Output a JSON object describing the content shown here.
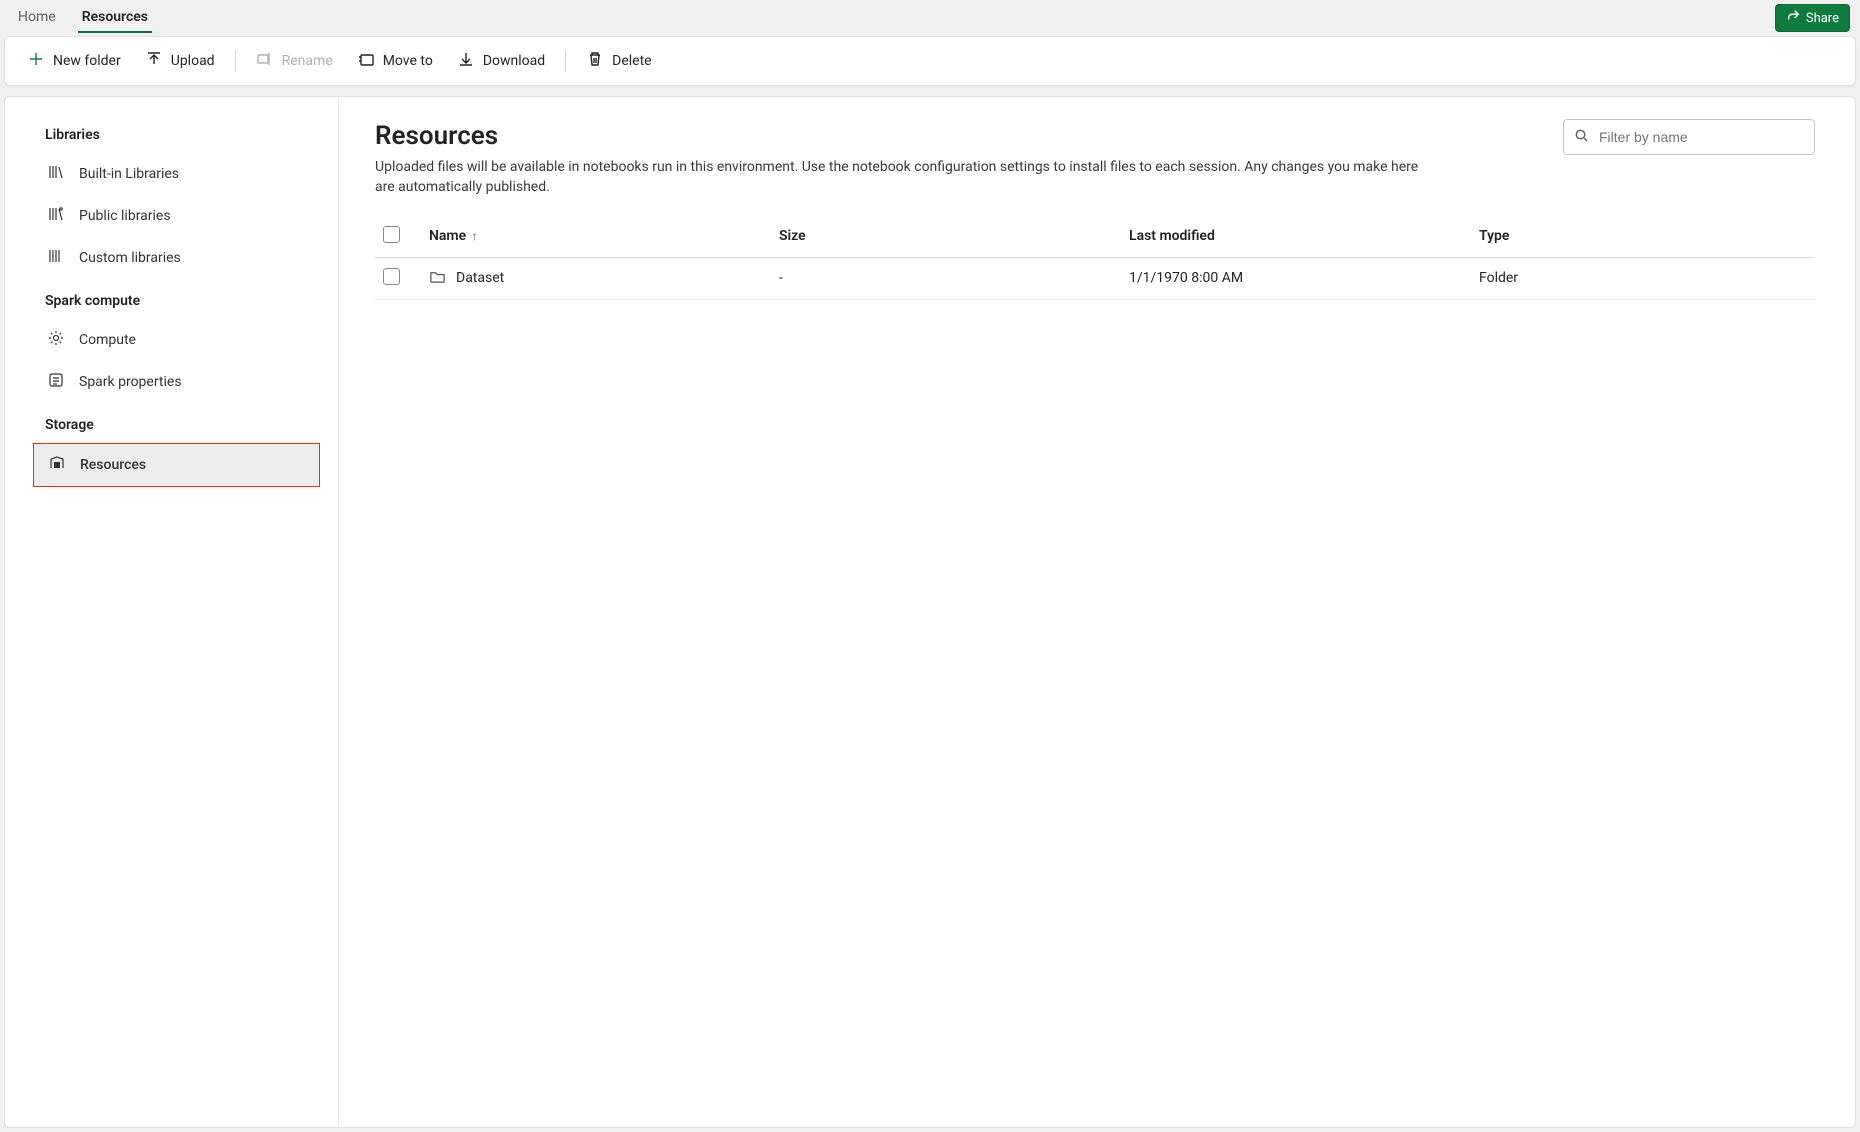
{
  "topbar": {
    "tabs": [
      {
        "label": "Home",
        "active": false
      },
      {
        "label": "Resources",
        "active": true
      }
    ],
    "share": "Share"
  },
  "toolbar": {
    "new_folder": "New folder",
    "upload": "Upload",
    "rename": "Rename",
    "move_to": "Move to",
    "download": "Download",
    "delete": "Delete"
  },
  "sidebar": {
    "groups": [
      {
        "title": "Libraries",
        "items": [
          {
            "label": "Built-in Libraries",
            "icon": "library-icon"
          },
          {
            "label": "Public libraries",
            "icon": "public-library-icon"
          },
          {
            "label": "Custom libraries",
            "icon": "custom-library-icon"
          }
        ]
      },
      {
        "title": "Spark compute",
        "items": [
          {
            "label": "Compute",
            "icon": "gear-icon"
          },
          {
            "label": "Spark properties",
            "icon": "properties-icon"
          }
        ]
      },
      {
        "title": "Storage",
        "items": [
          {
            "label": "Resources",
            "icon": "resources-icon",
            "selected": true
          }
        ]
      }
    ]
  },
  "content": {
    "title": "Resources",
    "description": "Uploaded files will be available in notebooks run in this environment. Use the notebook configuration settings to install files to each session. Any changes you make here are automatically published.",
    "filter_placeholder": "Filter by name",
    "columns": {
      "name": "Name",
      "size": "Size",
      "last_modified": "Last modified",
      "type": "Type"
    },
    "rows": [
      {
        "name": "Dataset",
        "size": "-",
        "last_modified": "1/1/1970 8:00 AM",
        "type": "Folder"
      }
    ]
  }
}
